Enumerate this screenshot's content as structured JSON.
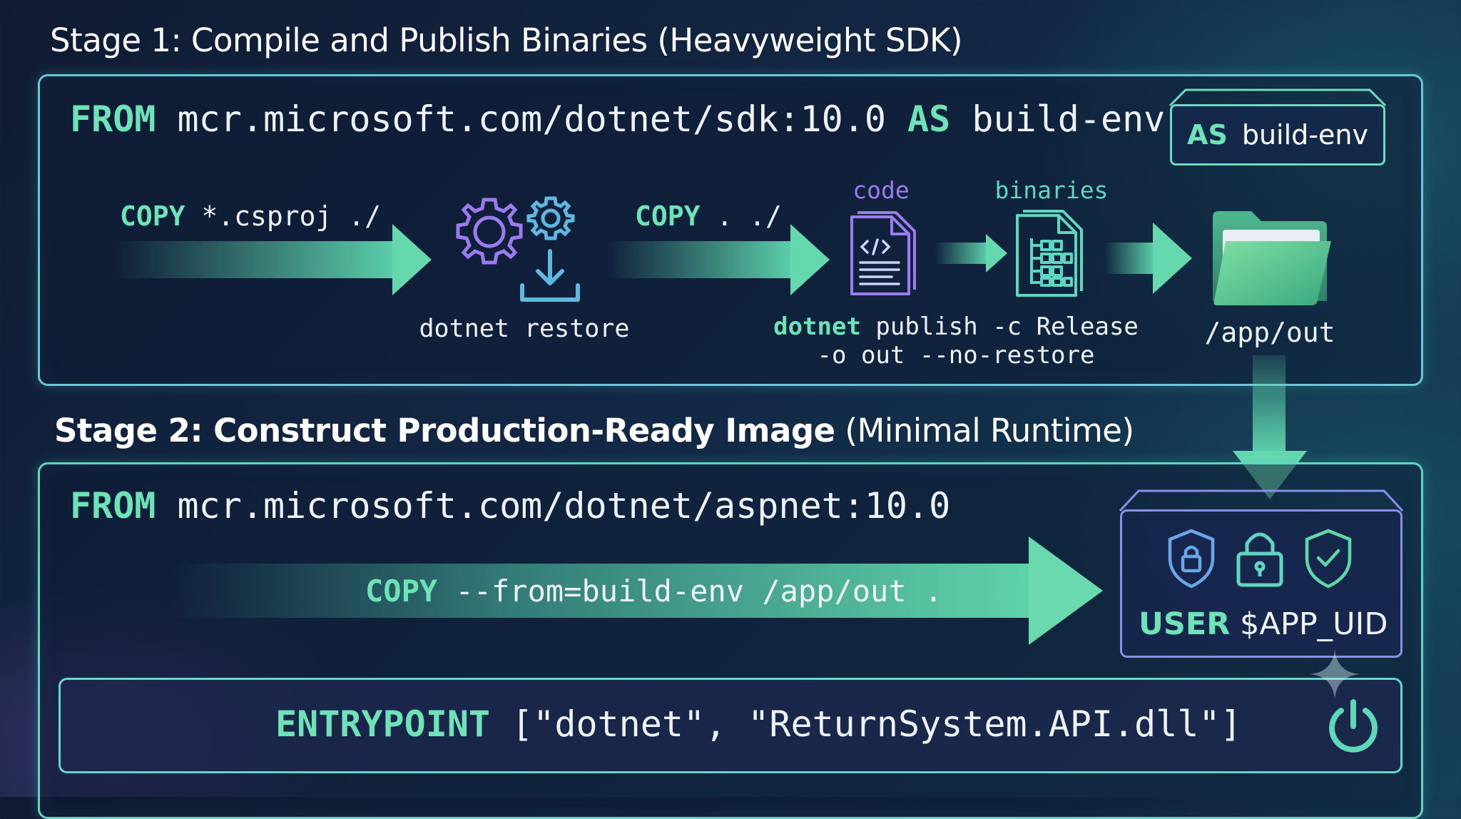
{
  "stage1": {
    "title": "Stage 1: Compile and Publish Binaries",
    "title_suffix": "(Heavyweight SDK)",
    "from_kw": "FROM",
    "image": "mcr.microsoft.com/dotnet/sdk:10.0",
    "as_kw": "AS",
    "alias": "build-env",
    "tag_kw": "AS",
    "tag_value": "build-env",
    "copy1_kw": "COPY",
    "copy1_args": "*.csproj ./",
    "restore_label": "dotnet restore",
    "copy2_kw": "COPY",
    "copy2_args": ". ./",
    "code_label": "code",
    "binaries_label": "binaries",
    "publish_kw": "dotnet",
    "publish_line1": "publish -c Release",
    "publish_line2": "-o out --no-restore",
    "output_path": "/app/out"
  },
  "stage2": {
    "title": "Stage 2: Construct Production-Ready Image",
    "title_suffix": "(Minimal Runtime)",
    "from_kw": "FROM",
    "image": "mcr.microsoft.com/dotnet/aspnet:10.0",
    "copy_kw": "COPY",
    "copy_args": "--from=build-env /app/out .",
    "user_kw": "USER",
    "user_value": "$APP_UID",
    "entry_kw": "ENTRYPOINT",
    "entry_args": "[\"dotnet\", \"ReturnSystem.API.dll\"]"
  },
  "colors": {
    "keyword": "#6fe3b8",
    "accent_purple": "#9a7cf0",
    "accent_teal": "#5fd7c0",
    "text": "#eef3fa"
  },
  "icons": [
    "gears-icon",
    "download-icon",
    "code-file-icon",
    "binary-file-icon",
    "folder-icon",
    "shield-lock-icon",
    "padlock-icon",
    "shield-check-icon",
    "power-icon"
  ]
}
